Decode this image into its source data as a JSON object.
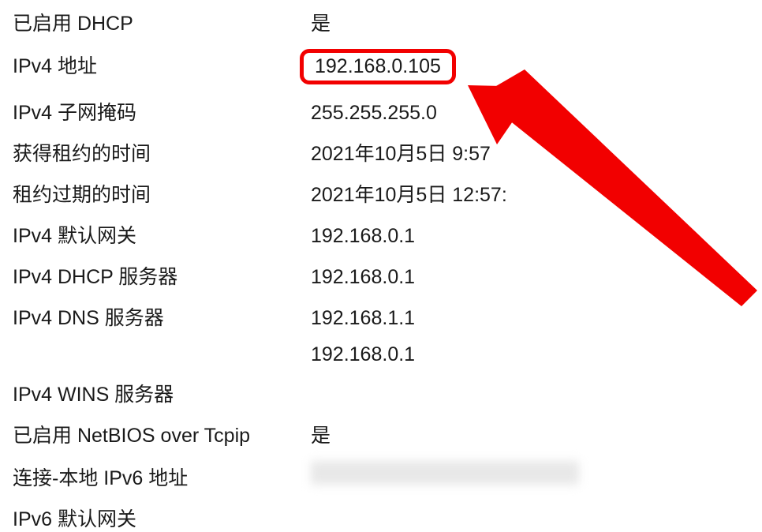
{
  "rows": [
    {
      "label": "已启用 DHCP",
      "value": "是"
    },
    {
      "label": "IPv4 地址",
      "value": "192.168.0.105",
      "highlight": true
    },
    {
      "label": "IPv4 子网掩码",
      "value": "255.255.255.0"
    },
    {
      "label": "获得租约的时间",
      "value": "2021年10月5日 9:57"
    },
    {
      "label": "租约过期的时间",
      "value": "2021年10月5日 12:57:"
    },
    {
      "label": "IPv4 默认网关",
      "value": "192.168.0.1"
    },
    {
      "label": "IPv4 DHCP 服务器",
      "value": "192.168.0.1"
    },
    {
      "label": "IPv4 DNS 服务器",
      "value": "192.168.1.1"
    },
    {
      "label": "",
      "value": "192.168.0.1"
    },
    {
      "label": "IPv4 WINS 服务器",
      "value": ""
    },
    {
      "label": "已启用 NetBIOS over Tcpip",
      "value": "是"
    },
    {
      "label": "连接-本地 IPv6 地址",
      "value": "",
      "blurred": true
    },
    {
      "label": "IPv6 默认网关",
      "value": ""
    }
  ],
  "annotation": {
    "highlight_color": "#f20000",
    "arrow_color": "#f20000"
  }
}
